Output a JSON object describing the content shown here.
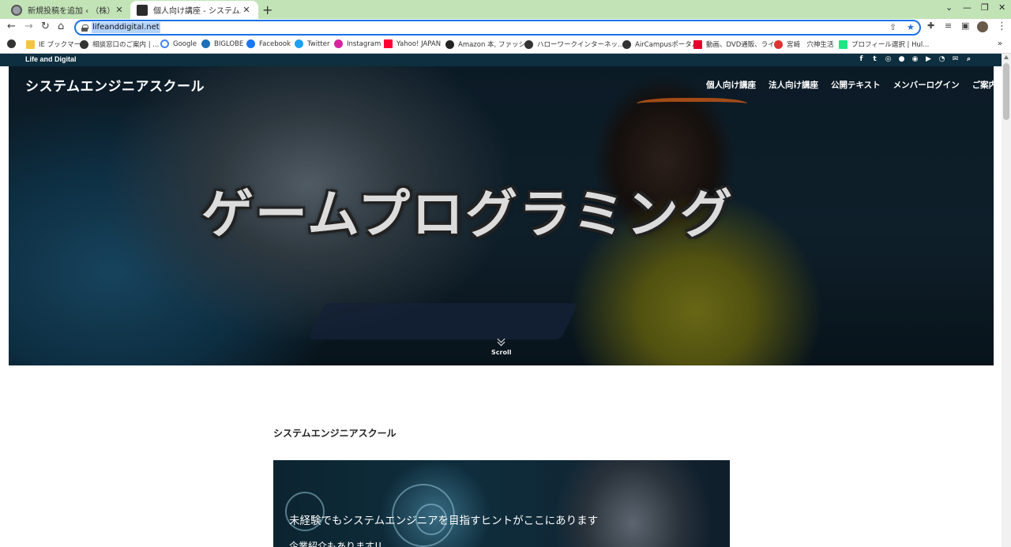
{
  "browser": {
    "tabs": [
      {
        "title": "新規投稿を追加 ‹ （株）ライフプラ",
        "active": false
      },
      {
        "title": "個人向け講座 - システムエンジニアス",
        "active": true
      }
    ],
    "url": "lifeanddigital.net",
    "bookmarks": [
      {
        "label": "",
        "icon": "globe-icon"
      },
      {
        "label": "IE ブックマーク",
        "icon": "folder-icon"
      },
      {
        "label": "相談窓口のご案内 | ...",
        "icon": "globe-icon"
      },
      {
        "label": "Google",
        "icon": "google-icon"
      },
      {
        "label": "BIGLOBE",
        "icon": "biglobe-icon"
      },
      {
        "label": "Facebook",
        "icon": "facebook-icon"
      },
      {
        "label": "Twitter",
        "icon": "twitter-icon"
      },
      {
        "label": "Instagram",
        "icon": "instagram-icon"
      },
      {
        "label": "Yahoo! JAPAN",
        "icon": "yahoo-icon"
      },
      {
        "label": "Amazon 本, ファッシ...",
        "icon": "amazon-icon"
      },
      {
        "label": "ハローワークインターネッ...",
        "icon": "globe-icon"
      },
      {
        "label": "AirCampusポータル",
        "icon": "globe-icon"
      },
      {
        "label": "動画、DVD通販、ライ...",
        "icon": "f-icon"
      },
      {
        "label": "宮崎　穴神生活",
        "icon": "site-icon"
      },
      {
        "label": "プロフィール選択 | Hul...",
        "icon": "hulu-icon"
      }
    ],
    "accent_color": "#1a73e8",
    "tabstrip_color": "#c2e3b6"
  },
  "site": {
    "topbar_brand": "Life and Digital",
    "social_icons": [
      "facebook-icon",
      "twitter-icon",
      "instagram-icon",
      "line-icon",
      "github-icon",
      "youtube-icon",
      "rss-icon",
      "mail-icon",
      "search-icon"
    ],
    "title": "システムエンジニアスクール",
    "nav": [
      "個人向け講座",
      "法人向け講座",
      "公開テキスト",
      "メンバーログイン",
      "ご案内"
    ],
    "hero_heading": "ゲームプログラミング",
    "scroll_label": "Scroll",
    "section_title": "システムエンジニアスクール",
    "banner_text": "未経験でもシステムエンジニアを目指すヒントがここにあります",
    "banner_text2": "企業紹介もあります!!",
    "topbar_color": "#0d2f3f"
  }
}
